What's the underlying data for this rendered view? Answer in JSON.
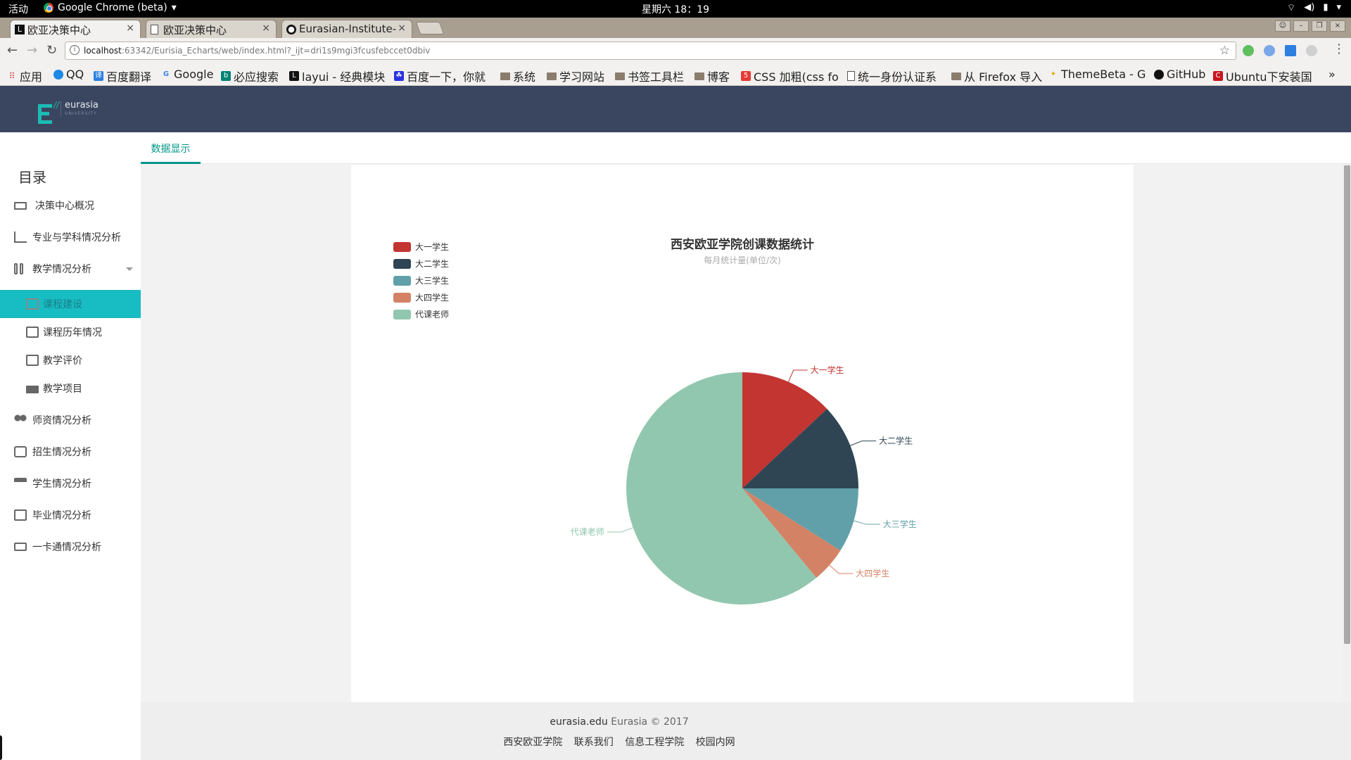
{
  "system_bar": {
    "activities": "活动",
    "app_name": "Google Chrome (beta)",
    "clock": "星期六 18：19"
  },
  "browser": {
    "tabs": [
      {
        "title": "欧亚决策中心",
        "icon": "layui-icon",
        "active": true
      },
      {
        "title": "欧亚决策中心",
        "icon": "page-icon",
        "active": false
      },
      {
        "title": "Eurasian-Institute-",
        "icon": "github-icon",
        "active": false
      }
    ],
    "url_host": "localhost",
    "url_rest": ":63342/Eurisia_Echarts/web/index.html?_ijt=dri1s9mgi3fcusfebccet0dbiv",
    "bookmarks": [
      {
        "label": "应用",
        "icon": "apps-grid-icon"
      },
      {
        "label": "QQ",
        "icon": "qq-icon"
      },
      {
        "label": "百度翻译",
        "icon": "translate-icon"
      },
      {
        "label": "Google",
        "icon": "google-icon"
      },
      {
        "label": "必应搜索",
        "icon": "bing-icon"
      },
      {
        "label": "layui - 经典模块",
        "icon": "layui-icon"
      },
      {
        "label": "百度一下，你就",
        "icon": "baidu-icon"
      },
      {
        "label": "系统",
        "icon": "folder-icon"
      },
      {
        "label": "学习网站",
        "icon": "folder-icon"
      },
      {
        "label": "书签工具栏",
        "icon": "folder-icon"
      },
      {
        "label": "博客",
        "icon": "folder-icon"
      },
      {
        "label": "CSS 加粗(css fo",
        "icon": "css-icon"
      },
      {
        "label": "统一身份认证系",
        "icon": "page-icon"
      },
      {
        "label": "从 Firefox 导入",
        "icon": "folder-icon"
      },
      {
        "label": "ThemeBeta - Gc",
        "icon": "theme-icon"
      },
      {
        "label": "GitHub",
        "icon": "github-icon"
      },
      {
        "label": "Ubuntu下安装国",
        "icon": "csdn-icon"
      }
    ]
  },
  "header": {
    "logo_text": "eurasia",
    "logo_sub": "UNIVERSITY"
  },
  "sidebar": {
    "title": "目录",
    "items": [
      {
        "label": "决策中心概况",
        "icon": "presentation-icon"
      },
      {
        "label": "专业与学科情况分析",
        "icon": "bar-chart-icon"
      },
      {
        "label": "教学情况分析",
        "icon": "columns-icon"
      },
      {
        "label": "课程建设",
        "icon": "book-icon"
      },
      {
        "label": "课程历年情况",
        "icon": "chat-icon"
      },
      {
        "label": "教学评价",
        "icon": "edit-icon"
      },
      {
        "label": "教学项目",
        "icon": "folder-icon"
      },
      {
        "label": "师资情况分析",
        "icon": "people-icon"
      },
      {
        "label": "招生情况分析",
        "icon": "badge-icon"
      },
      {
        "label": "学生情况分析",
        "icon": "graduate-icon"
      },
      {
        "label": "毕业情况分析",
        "icon": "certificate-icon"
      },
      {
        "label": "一卡通情况分析",
        "icon": "card-icon"
      }
    ]
  },
  "tabs": {
    "data_display": "数据显示"
  },
  "chart_data": {
    "type": "pie",
    "title": "西安欧亚学院创课数据统计",
    "subtitle": "每月统计量(单位/次)",
    "legend_position": "top-left",
    "categories": [
      "大一学生",
      "大二学生",
      "大三学生",
      "大四学生",
      "代课老师"
    ],
    "values": [
      13,
      12,
      9,
      5,
      61
    ],
    "colors": [
      "#c23531",
      "#2f4554",
      "#61a0a8",
      "#d48265",
      "#91c7ae"
    ]
  },
  "footer": {
    "brand": "eurasia.edu",
    "copyright": "Eurasia © 2017",
    "links": [
      "西安欧亚学院",
      "联系我们",
      "信息工程学院",
      "校园内网"
    ]
  }
}
